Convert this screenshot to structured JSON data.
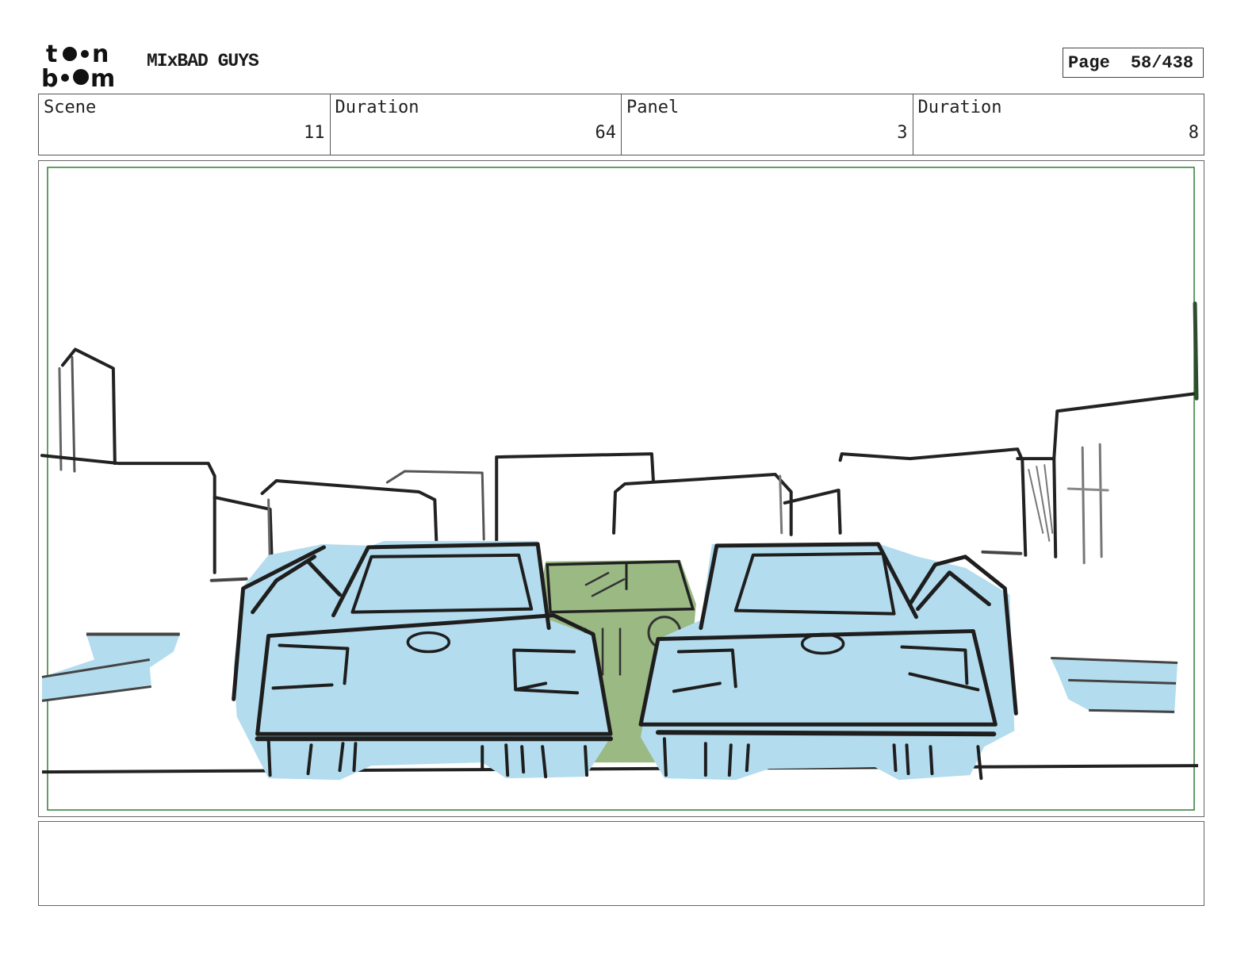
{
  "header": {
    "logo_text": "toon boom",
    "project_title": "MIxBAD GUYS",
    "page_label": "Page",
    "page_value": "58/438"
  },
  "info": {
    "scene_label": "Scene",
    "scene_value": "11",
    "scene_duration_label": "Duration",
    "scene_duration_value": "64",
    "panel_label": "Panel",
    "panel_value": "3",
    "panel_duration_label": "Duration",
    "panel_duration_value": "8"
  },
  "panel": {
    "safe_frame_color": "#2e7d32",
    "car_fill": "#b3dcee",
    "middle_car_fill": "#9ab983",
    "line_color": "#1e1e1e"
  },
  "notes": {
    "text": ""
  }
}
